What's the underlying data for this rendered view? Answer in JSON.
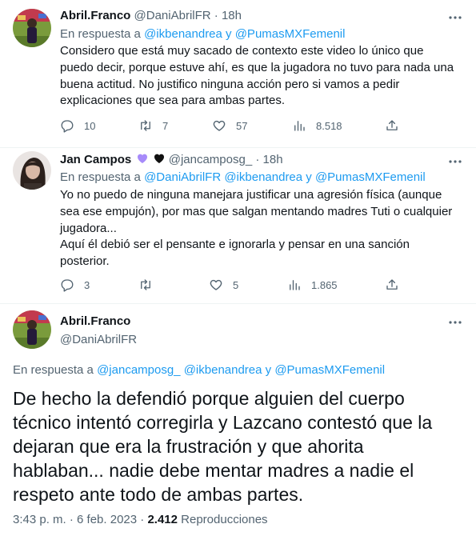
{
  "tweet1": {
    "name": "Abril.Franco",
    "handle": "@DaniAbrilFR",
    "sep": "·",
    "time": "18h",
    "reply_prefix": "En respuesta a",
    "reply_to": "@ikbenandrea y @PumasMXFemenil",
    "lines": [
      "Considero que está muy sacado de contexto este video lo único que",
      "puedo decir, porque estuve ahí, es que la jugadora no tuvo para nada una",
      "buena actitud. No justifico ninguna acción pero si vamos a pedir",
      "explicaciones que sea para ambas partes."
    ],
    "replies": "10",
    "retweets": "7",
    "likes": "57",
    "views": "8.518"
  },
  "tweet2": {
    "name": "Jan Campos",
    "emoji": [
      "purple-heart-icon",
      "black-heart-icon"
    ],
    "heart_colors": [
      "#a78bfa",
      "#111111"
    ],
    "handle": "@jancamposg_",
    "sep": "·",
    "time": "18h",
    "reply_prefix": "En respuesta a",
    "reply_to": "@DaniAbrilFR @ikbenandrea y @PumasMXFemenil",
    "lines": [
      "Yo no puedo de ninguna manejara justificar una agresión física (aunque",
      "sea ese empujón), por mas que salgan mentando madres Tuti o cualquier",
      "jugadora...",
      "Aquí él debió ser el pensante e ignorarla y pensar en una sanción",
      "posterior."
    ],
    "replies": "3",
    "retweets": "",
    "likes": "5",
    "views": "1.865"
  },
  "main": {
    "name": "Abril.Franco",
    "handle": "@DaniAbrilFR",
    "reply_prefix": "En respuesta a",
    "reply_to": "@jancamposg_ @ikbenandrea y @PumasMXFemenil",
    "lines": [
      "De hecho la defendió porque alguien del cuerpo",
      "técnico intentó corregirla y Lazcano contestó que la",
      "dejaran que era la frustración y que ahorita",
      "hablaban... nadie debe mentar madres a nadie el",
      "respeto ante todo de ambas partes."
    ],
    "time": "3:43 p. m. · 6 feb. 2023 ·",
    "views_count": "2.412",
    "views_label": "Reproducciones"
  },
  "colors": {
    "accent": "#1d9bf0",
    "muted": "#536471",
    "text": "#0f1419",
    "divider": "#eff3f4"
  }
}
